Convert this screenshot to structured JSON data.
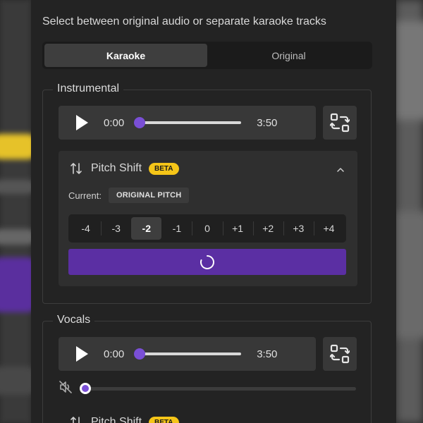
{
  "subtitle": "Select between original audio or separate karaoke tracks",
  "mode_tabs": [
    {
      "label": "Karaoke",
      "active": true
    },
    {
      "label": "Original",
      "active": false
    }
  ],
  "instrumental": {
    "legend": "Instrumental",
    "player": {
      "current_time": "0:00",
      "duration": "3:50",
      "progress": 0
    },
    "pitch_shift": {
      "title": "Pitch Shift",
      "badge": "BETA",
      "expanded": true,
      "current_label": "Current:",
      "current_value": "ORIGINAL PITCH",
      "semitones": [
        "-4",
        "-3",
        "-2",
        "-1",
        "0",
        "+1",
        "+2",
        "+3",
        "+4"
      ],
      "selected": "-2",
      "apply_state": "loading"
    }
  },
  "vocals": {
    "legend": "Vocals",
    "player": {
      "current_time": "0:00",
      "duration": "3:50",
      "progress": 0
    },
    "volume": {
      "muted": true,
      "level": 0
    },
    "pitch_shift": {
      "title": "Pitch Shift",
      "badge": "BETA"
    }
  },
  "icons": {
    "play": "play-icon",
    "swap": "swap-arrows-icon",
    "pitch": "up-down-arrows-icon",
    "collapse": "chevron-up-icon",
    "mute": "volume-muted-icon",
    "loading": "spinner-icon"
  },
  "colors": {
    "accent": "#7a4fd6",
    "apply_button": "#5b2fa3",
    "beta_badge": "#f5c518",
    "panel_bg": "#232323"
  }
}
